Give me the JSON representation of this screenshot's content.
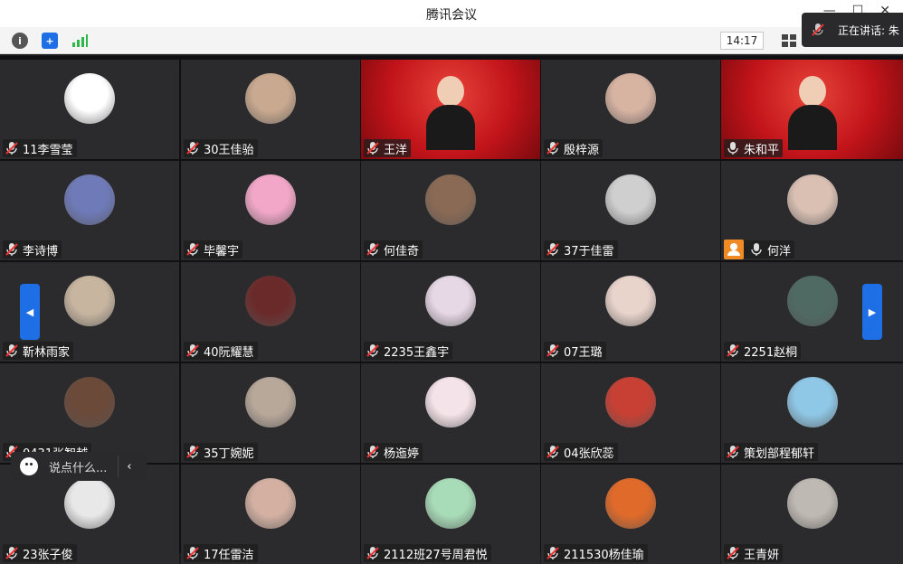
{
  "window": {
    "title": "腾讯会议"
  },
  "toolbar": {
    "clock": "14:17"
  },
  "speaking": {
    "label": "正在讲话: 朱"
  },
  "chat": {
    "placeholder": "说点什么..."
  },
  "participants": [
    {
      "name": "11李雪莹",
      "mic": "muted",
      "type": "avatar",
      "color": "#ffffff"
    },
    {
      "name": "30王佳骀",
      "mic": "muted",
      "type": "avatar",
      "color": "#c9a98f"
    },
    {
      "name": "王洋",
      "mic": "muted",
      "type": "video",
      "color": "#c2141a"
    },
    {
      "name": "殷梓源",
      "mic": "muted",
      "type": "avatar",
      "color": "#d7b3a2"
    },
    {
      "name": "朱和平",
      "mic": "on",
      "type": "video",
      "color": "#c2141a"
    },
    {
      "name": "李诗博",
      "mic": "muted",
      "type": "avatar",
      "color": "#6f7bb8"
    },
    {
      "name": "毕馨宇",
      "mic": "muted",
      "type": "avatar",
      "color": "#f3a7c8"
    },
    {
      "name": "何佳奇",
      "mic": "muted",
      "type": "avatar",
      "color": "#8a6a55"
    },
    {
      "name": "37于佳雷",
      "mic": "muted",
      "type": "avatar",
      "color": "#cfcfcf"
    },
    {
      "name": "何洋",
      "mic": "on",
      "type": "avatar",
      "color": "#d9c0b3",
      "host": true
    },
    {
      "name": "靳林雨家",
      "mic": "muted",
      "type": "avatar",
      "color": "#c7b5a0"
    },
    {
      "name": "40阮耀慧",
      "mic": "muted",
      "type": "avatar",
      "color": "#6b2a2a"
    },
    {
      "name": "2235王鑫宇",
      "mic": "muted",
      "type": "avatar",
      "color": "#e7d8e6"
    },
    {
      "name": "07王璐",
      "mic": "muted",
      "type": "avatar",
      "color": "#e9d4cc"
    },
    {
      "name": "2251赵桐",
      "mic": "muted",
      "type": "avatar",
      "color": "#4f6a63"
    },
    {
      "name": "0431张智越",
      "mic": "muted",
      "type": "avatar",
      "color": "#6b4a3a"
    },
    {
      "name": "35丁婉妮",
      "mic": "muted",
      "type": "avatar",
      "color": "#b8a89a"
    },
    {
      "name": "杨迤婷",
      "mic": "muted",
      "type": "avatar",
      "color": "#f4e3e8"
    },
    {
      "name": "04张欣蕊",
      "mic": "muted",
      "type": "avatar",
      "color": "#c84034"
    },
    {
      "name": "策划部程郁轩",
      "mic": "muted",
      "type": "avatar",
      "color": "#8fc7e6"
    },
    {
      "name": "23张子俊",
      "mic": "muted",
      "type": "avatar",
      "color": "#e8e8e8"
    },
    {
      "name": "17任雷洁",
      "mic": "muted",
      "type": "avatar",
      "color": "#d3b0a2"
    },
    {
      "name": "2112班27号周君悦",
      "mic": "muted",
      "type": "avatar",
      "color": "#a8dcb8"
    },
    {
      "name": "211530杨佳瑜",
      "mic": "muted",
      "type": "avatar",
      "color": "#e06a2a"
    },
    {
      "name": "王青妍",
      "mic": "muted",
      "type": "avatar",
      "color": "#bfb9b3"
    }
  ]
}
